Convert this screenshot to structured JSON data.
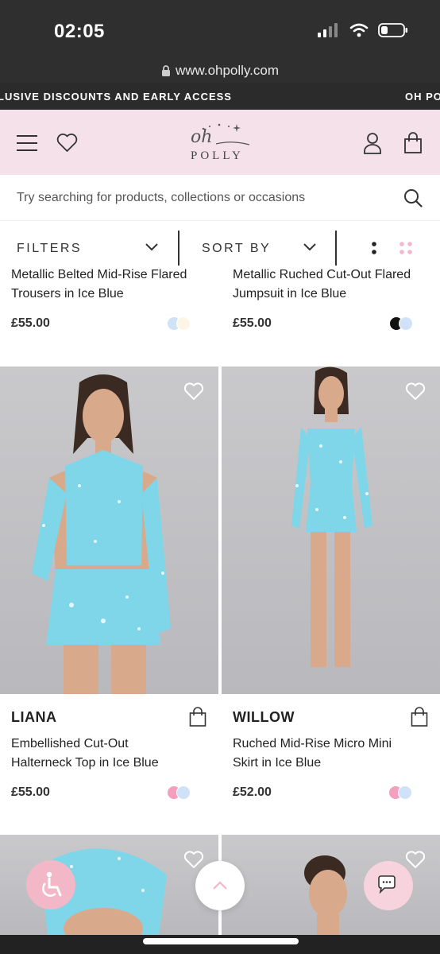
{
  "status": {
    "time": "02:05"
  },
  "browser": {
    "url": "www.ohpolly.com"
  },
  "promo": {
    "left_text": "LUSIVE DISCOUNTS AND EARLY ACCESS",
    "right_text": "OH PO"
  },
  "header": {
    "logo_oh": "oh",
    "logo_polly": "POLLY"
  },
  "search": {
    "placeholder": "Try searching for products, collections or occasions"
  },
  "toolbar": {
    "filters_label": "FILTERS",
    "sort_label": "SORT BY"
  },
  "products_top": [
    {
      "title_line1": "Metallic Belted Mid-Rise Flared",
      "title_line2": "Trousers in Ice Blue",
      "price": "£55.00",
      "swatches": [
        "#cfe2f7",
        "#fdf6e6"
      ]
    },
    {
      "title_line1": "Metallic Ruched Cut-Out Flared",
      "title_line2": "Jumpsuit in Ice Blue",
      "price": "£55.00",
      "swatches": [
        "#111111",
        "#cfe2f7"
      ]
    }
  ],
  "products": [
    {
      "brand": "LIANA",
      "title_line1": "Embellished Cut-Out",
      "title_line2": "Halterneck Top in Ice Blue",
      "price": "£55.00",
      "swatches": [
        "#f39fbd",
        "#cfe2f7"
      ]
    },
    {
      "brand": "WILLOW",
      "title_line1": "Ruched Mid-Rise Micro Mini",
      "title_line2": "Skirt in Ice Blue",
      "price": "£52.00",
      "swatches": [
        "#f39fbd",
        "#cfe2f7"
      ]
    }
  ],
  "colors": {
    "header_bg": "#f4e1ea",
    "garment": "#7fd6e8",
    "accent_pink": "#f2b8c7"
  }
}
